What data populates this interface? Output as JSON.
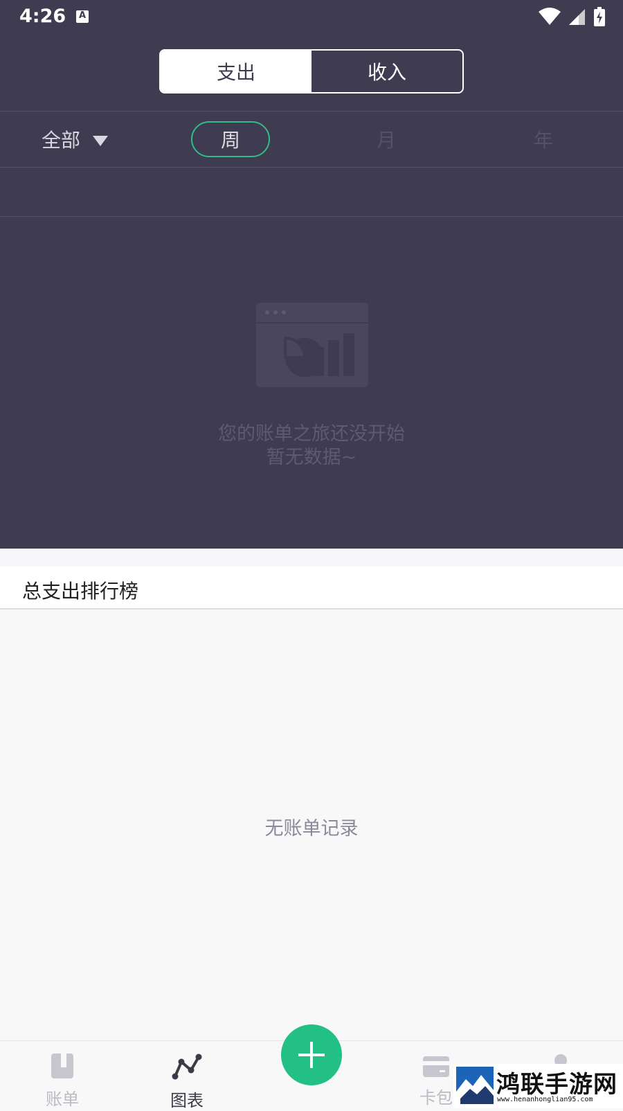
{
  "status_bar": {
    "time": "4:26",
    "notification_letter": "A"
  },
  "segment": {
    "expense_label": "支出",
    "income_label": "收入",
    "selected": "expense"
  },
  "filter": {
    "category_label": "全部",
    "periods": {
      "week": "周",
      "month": "月",
      "year": "年"
    },
    "selected_period": "week"
  },
  "empty_state": {
    "line1": "您的账单之旅还没开始",
    "line2": "暂无数据~"
  },
  "ranking": {
    "title": "总支出排行榜",
    "empty_text": "无账单记录"
  },
  "tabbar": {
    "items": [
      {
        "label": "账单",
        "icon": "book-icon",
        "active": false
      },
      {
        "label": "图表",
        "icon": "chart-line-icon",
        "active": true
      },
      {
        "label": "卡包",
        "icon": "card-icon",
        "active": false
      },
      {
        "label": "",
        "icon": "person-icon",
        "active": false
      }
    ],
    "add_icon": "plus-icon"
  },
  "watermark": {
    "title": "鸿联手游网",
    "url": "www.henanhonglian95.com"
  },
  "colors": {
    "header_bg": "#3f3b50",
    "accent_green": "#22c084",
    "period_border": "#2fbf86"
  }
}
